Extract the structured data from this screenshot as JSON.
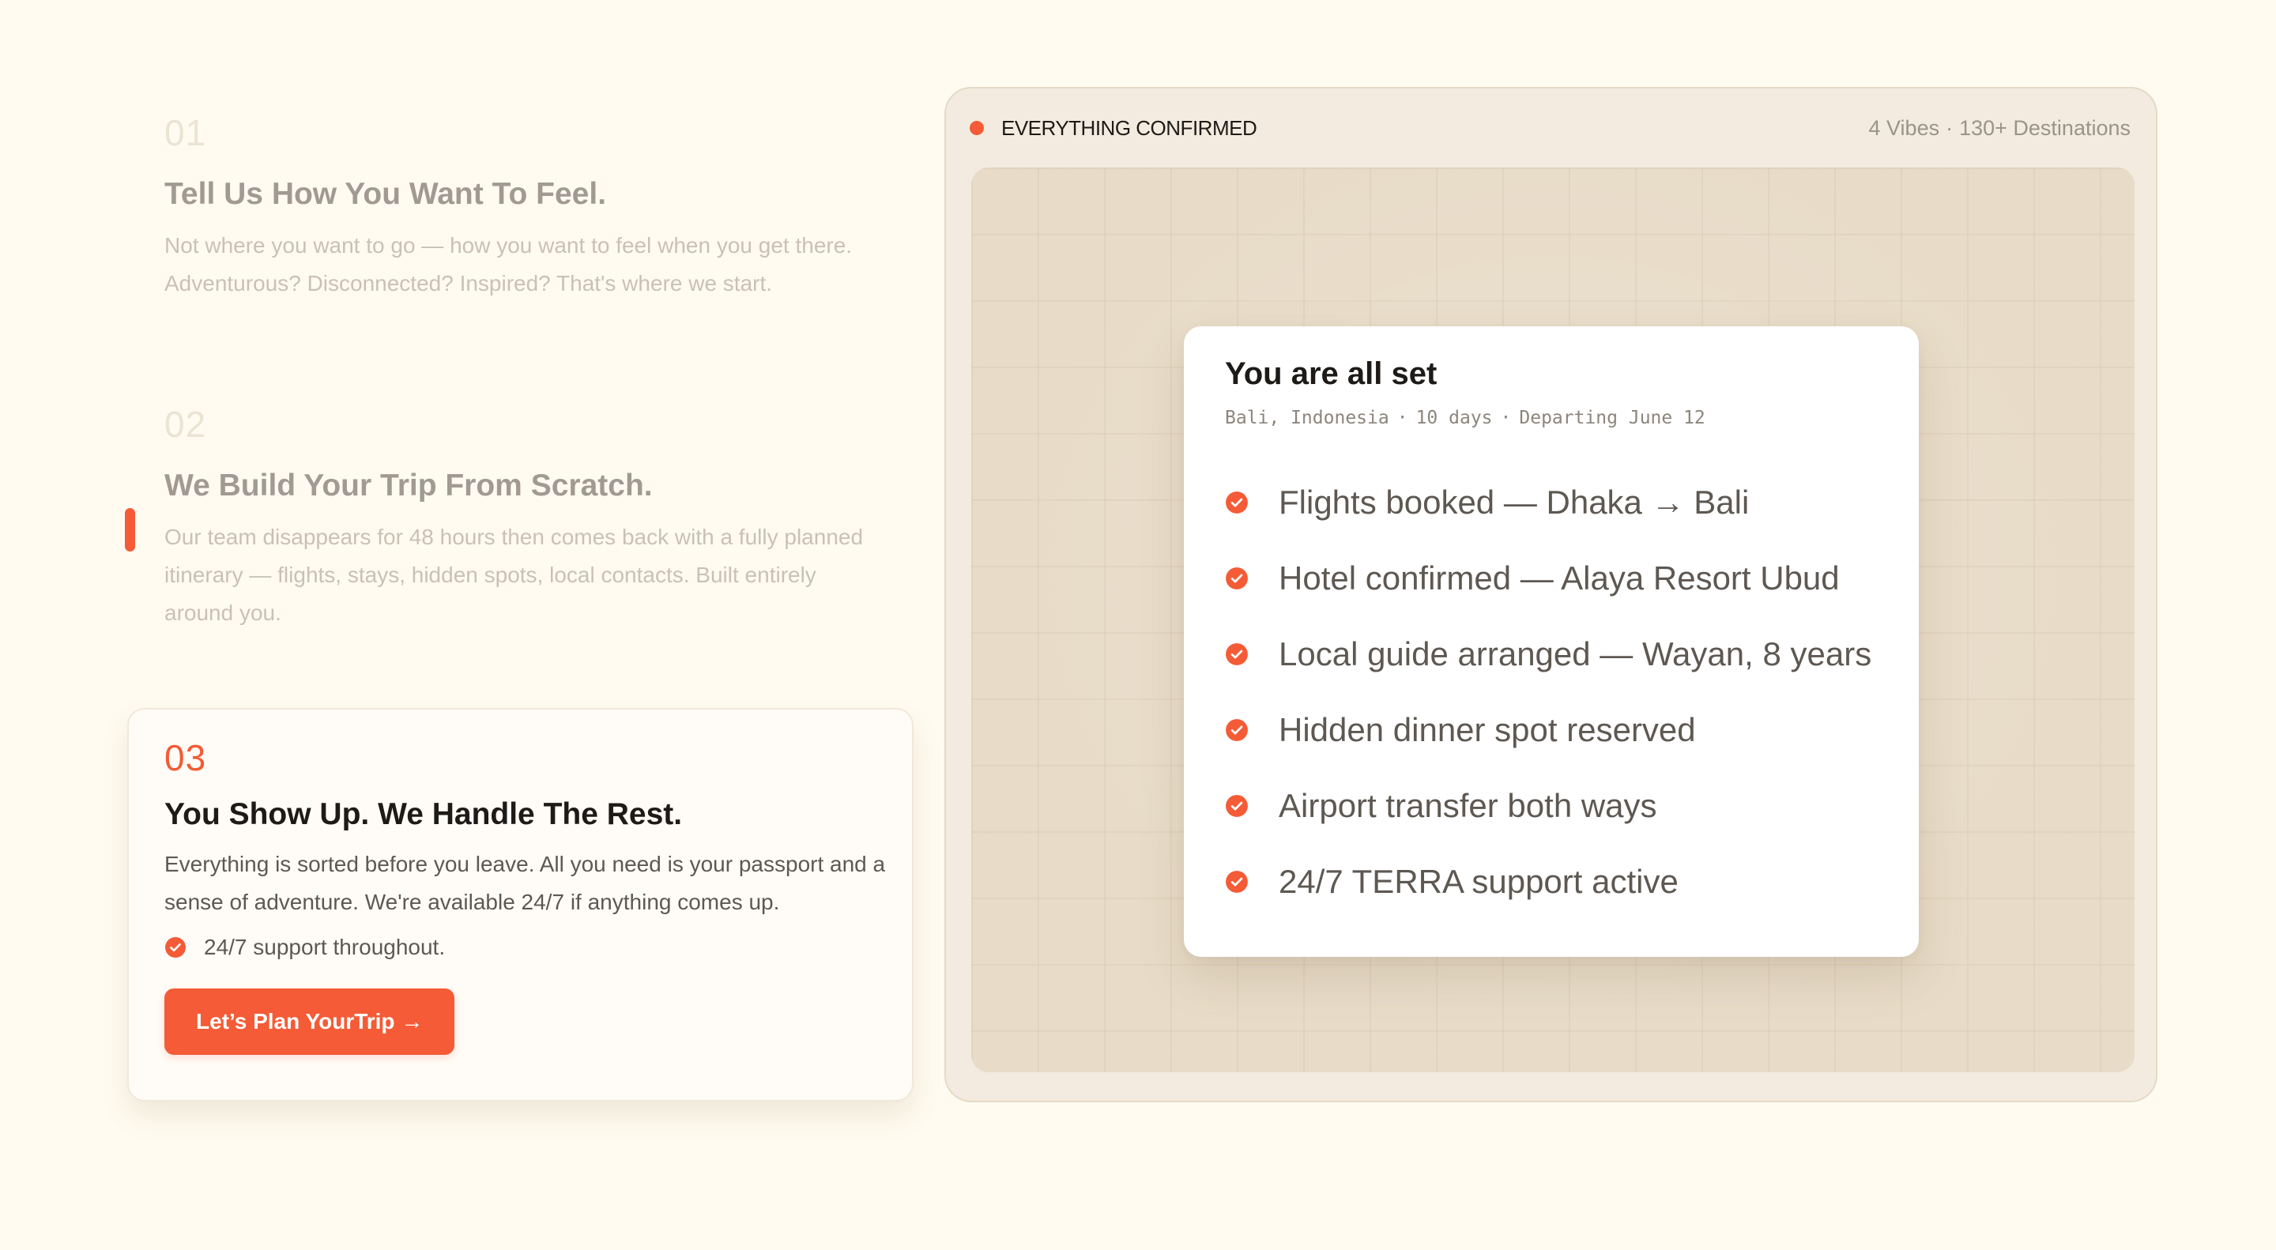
{
  "steps": [
    {
      "number": "01",
      "title": "Tell Us How You Want To Feel.",
      "description": "Not where you want to go — how you want to feel when you get there. Adventurous? Disconnected? Inspired? That's where we start."
    },
    {
      "number": "02",
      "title": "We Build Your Trip From Scratch.",
      "description": "Our team disappears for 48 hours then comes back with a fully planned itinerary — flights, stays, hidden spots, local contacts. Built entirely around you."
    },
    {
      "number": "03",
      "title": "You Show Up. We Handle The Rest.",
      "description": "Everything is sorted before you leave. All you need is your passport and a sense of adventure. We're available 24/7 if anything comes up.",
      "support_note": "24/7 support throughout.",
      "cta_label": "Let’s Plan YourTrip →"
    }
  ],
  "panel": {
    "status_label": "EVERYTHING CONFIRMED",
    "meta": [
      "4 Vibes",
      "130+ Destinations"
    ],
    "separator": "·"
  },
  "confirmation": {
    "title": "You are all set",
    "details": [
      "Bali, Indonesia",
      "10 days",
      "Departing June 12"
    ],
    "items": [
      "Flights booked — Dhaka → Bali",
      "Hotel confirmed — Alaya Resort Ubud",
      "Local guide arranged — Wayan, 8 years",
      "Hidden dinner spot reserved",
      "Airport transfer both ways",
      "24/7 TERRA support active"
    ]
  },
  "icons": {
    "check": "check-circle-icon",
    "status": "status-dot-icon"
  },
  "colors": {
    "accent": "#f45b36",
    "background": "#fffbf0",
    "panel": "#f3ebdf",
    "map": "#e8dcc8"
  }
}
